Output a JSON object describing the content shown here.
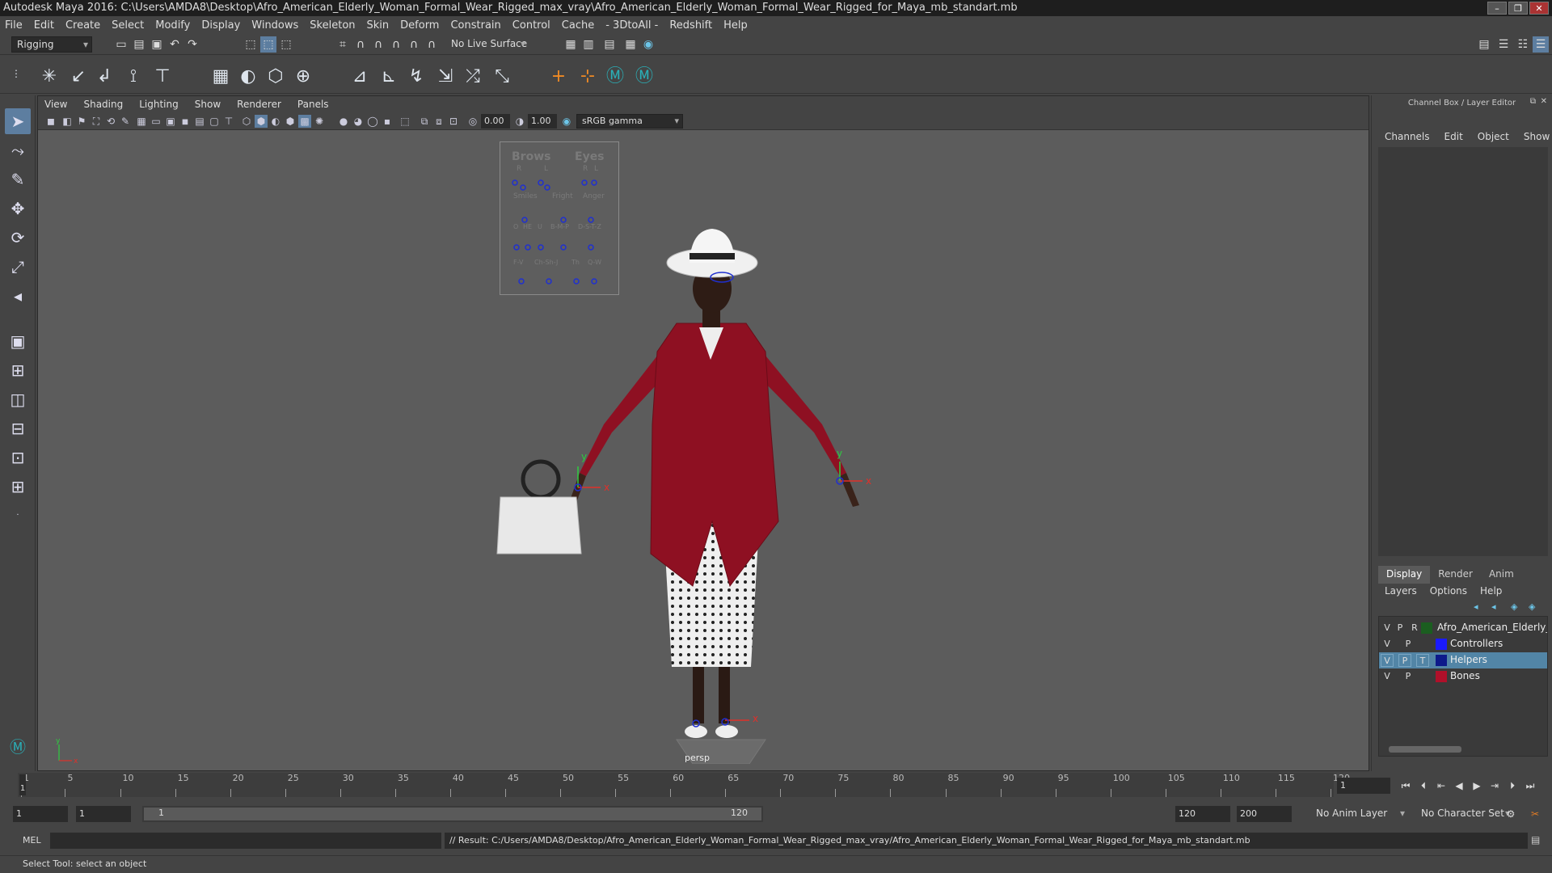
{
  "window": {
    "title": "Autodesk Maya 2016: C:\\Users\\AMDA8\\Desktop\\Afro_American_Elderly_Woman_Formal_Wear_Rigged_max_vray\\Afro_American_Elderly_Woman_Formal_Wear_Rigged_for_Maya_mb_standart.mb",
    "controls": [
      "–",
      "❐",
      "✕"
    ]
  },
  "menubar": [
    "File",
    "Edit",
    "Create",
    "Select",
    "Modify",
    "Display",
    "Windows",
    "Skeleton",
    "Skin",
    "Deform",
    "Constrain",
    "Control",
    "Cache",
    "- 3DtoAll -",
    "Redshift",
    "Help"
  ],
  "statusline": {
    "menuset": "Rigging",
    "live_surface": "No Live Surface"
  },
  "viewport": {
    "menu": [
      "View",
      "Shading",
      "Lighting",
      "Show",
      "Renderer",
      "Panels"
    ],
    "exposure": "0.00",
    "gamma": "1.00",
    "colorspace": "sRGB gamma",
    "camera_label": "persp",
    "face_panel": {
      "headers": [
        "Brows",
        "Eyes"
      ],
      "rl_brows": [
        "R",
        "L"
      ],
      "rl_eyes": [
        "R",
        "L"
      ],
      "row2": [
        "Smiles",
        "Fright",
        "Anger"
      ],
      "row3": [
        "O",
        "HE",
        "U",
        "B-M-P",
        "D-S-T-Z"
      ],
      "row4": [
        "F-V",
        "Ch-Sh-J",
        "Th",
        "Q-W"
      ]
    },
    "axis_labels": {
      "x": "x",
      "y": "y",
      "z": "z"
    }
  },
  "channel_box": {
    "title": "Channel Box / Layer Editor",
    "menu": [
      "Channels",
      "Edit",
      "Object",
      "Show"
    ],
    "layer_tabs": [
      "Display",
      "Render",
      "Anim"
    ],
    "layer_menu": [
      "Layers",
      "Options",
      "Help"
    ],
    "layers": [
      {
        "v": "V",
        "p": "P",
        "r": "R",
        "name": "Afro_American_Elderly_W",
        "color": "#1b5e20",
        "selected": false
      },
      {
        "v": "V",
        "p": "P",
        "r": "",
        "name": "Controllers",
        "color": "#1a1aff",
        "selected": false
      },
      {
        "v": "V",
        "p": "P",
        "r": "T",
        "name": "Helpers",
        "color": "#0d1a8a",
        "selected": true
      },
      {
        "v": "V",
        "p": "P",
        "r": "",
        "name": "Bones",
        "color": "#b0102a",
        "selected": false
      }
    ]
  },
  "timeline": {
    "ticks": [
      "1",
      "5",
      "10",
      "15",
      "20",
      "25",
      "30",
      "35",
      "40",
      "45",
      "50",
      "55",
      "60",
      "65",
      "70",
      "75",
      "80",
      "85",
      "90",
      "95",
      "100",
      "105",
      "110",
      "115",
      "120"
    ],
    "current_frame": "1",
    "current_frame_marker": "1"
  },
  "range": {
    "start": "1",
    "playback_start": "1",
    "slider_start": "1",
    "slider_end": "120",
    "playback_end": "120",
    "end": "200",
    "anim_layer": "No Anim Layer",
    "character_set": "No Character Set"
  },
  "command": {
    "lang": "MEL",
    "result": "// Result: C:/Users/AMDA8/Desktop/Afro_American_Elderly_Woman_Formal_Wear_Rigged_max_vray/Afro_American_Elderly_Woman_Formal_Wear_Rigged_for_Maya_mb_standart.mb"
  },
  "help_line": "Select Tool: select an object",
  "colors": {
    "accent": "#5285a6",
    "dress": "#8e1022",
    "viewport_bg": "#5c5c5c"
  }
}
